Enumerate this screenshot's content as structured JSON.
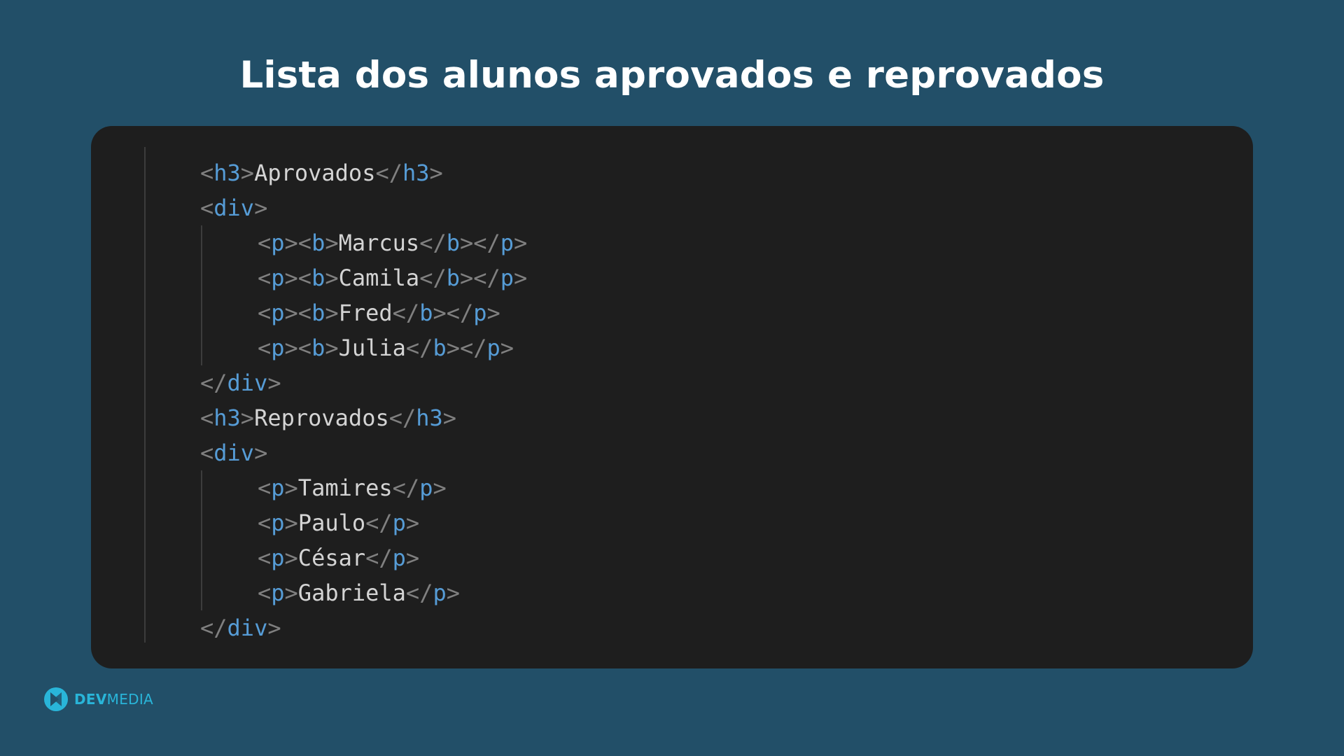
{
  "title": "Lista dos alunos aprovados e reprovados",
  "colors": {
    "background": "#224f68",
    "panel": "#1e1e1e",
    "tag": "#569cd6",
    "punctuation": "#808080",
    "text": "#d4d4d4",
    "brand": "#29b5d9"
  },
  "code": {
    "lines": [
      {
        "indent": 1,
        "tokens": [
          [
            "punct",
            "<"
          ],
          [
            "tag",
            "h3"
          ],
          [
            "punct",
            ">"
          ],
          [
            "text",
            "Aprovados"
          ],
          [
            "punct",
            "</"
          ],
          [
            "tag",
            "h3"
          ],
          [
            "punct",
            ">"
          ]
        ]
      },
      {
        "indent": 1,
        "tokens": [
          [
            "punct",
            "<"
          ],
          [
            "tag",
            "div"
          ],
          [
            "punct",
            ">"
          ]
        ]
      },
      {
        "indent": 2,
        "tokens": [
          [
            "punct",
            "<"
          ],
          [
            "tag",
            "p"
          ],
          [
            "punct",
            "><"
          ],
          [
            "tag",
            "b"
          ],
          [
            "punct",
            ">"
          ],
          [
            "text",
            "Marcus"
          ],
          [
            "punct",
            "</"
          ],
          [
            "tag",
            "b"
          ],
          [
            "punct",
            "></"
          ],
          [
            "tag",
            "p"
          ],
          [
            "punct",
            ">"
          ]
        ]
      },
      {
        "indent": 2,
        "tokens": [
          [
            "punct",
            "<"
          ],
          [
            "tag",
            "p"
          ],
          [
            "punct",
            "><"
          ],
          [
            "tag",
            "b"
          ],
          [
            "punct",
            ">"
          ],
          [
            "text",
            "Camila"
          ],
          [
            "punct",
            "</"
          ],
          [
            "tag",
            "b"
          ],
          [
            "punct",
            "></"
          ],
          [
            "tag",
            "p"
          ],
          [
            "punct",
            ">"
          ]
        ]
      },
      {
        "indent": 2,
        "tokens": [
          [
            "punct",
            "<"
          ],
          [
            "tag",
            "p"
          ],
          [
            "punct",
            "><"
          ],
          [
            "tag",
            "b"
          ],
          [
            "punct",
            ">"
          ],
          [
            "text",
            "Fred"
          ],
          [
            "punct",
            "</"
          ],
          [
            "tag",
            "b"
          ],
          [
            "punct",
            "></"
          ],
          [
            "tag",
            "p"
          ],
          [
            "punct",
            ">"
          ]
        ]
      },
      {
        "indent": 2,
        "tokens": [
          [
            "punct",
            "<"
          ],
          [
            "tag",
            "p"
          ],
          [
            "punct",
            "><"
          ],
          [
            "tag",
            "b"
          ],
          [
            "punct",
            ">"
          ],
          [
            "text",
            "Julia"
          ],
          [
            "punct",
            "</"
          ],
          [
            "tag",
            "b"
          ],
          [
            "punct",
            "></"
          ],
          [
            "tag",
            "p"
          ],
          [
            "punct",
            ">"
          ]
        ]
      },
      {
        "indent": 1,
        "tokens": [
          [
            "punct",
            "</"
          ],
          [
            "tag",
            "div"
          ],
          [
            "punct",
            ">"
          ]
        ]
      },
      {
        "indent": 1,
        "tokens": [
          [
            "punct",
            "<"
          ],
          [
            "tag",
            "h3"
          ],
          [
            "punct",
            ">"
          ],
          [
            "text",
            "Reprovados"
          ],
          [
            "punct",
            "</"
          ],
          [
            "tag",
            "h3"
          ],
          [
            "punct",
            ">"
          ]
        ]
      },
      {
        "indent": 1,
        "tokens": [
          [
            "punct",
            "<"
          ],
          [
            "tag",
            "div"
          ],
          [
            "punct",
            ">"
          ]
        ]
      },
      {
        "indent": 2,
        "tokens": [
          [
            "punct",
            "<"
          ],
          [
            "tag",
            "p"
          ],
          [
            "punct",
            ">"
          ],
          [
            "text",
            "Tamires"
          ],
          [
            "punct",
            "</"
          ],
          [
            "tag",
            "p"
          ],
          [
            "punct",
            ">"
          ]
        ]
      },
      {
        "indent": 2,
        "tokens": [
          [
            "punct",
            "<"
          ],
          [
            "tag",
            "p"
          ],
          [
            "punct",
            ">"
          ],
          [
            "text",
            "Paulo"
          ],
          [
            "punct",
            "</"
          ],
          [
            "tag",
            "p"
          ],
          [
            "punct",
            ">"
          ]
        ]
      },
      {
        "indent": 2,
        "tokens": [
          [
            "punct",
            "<"
          ],
          [
            "tag",
            "p"
          ],
          [
            "punct",
            ">"
          ],
          [
            "text",
            "César"
          ],
          [
            "punct",
            "</"
          ],
          [
            "tag",
            "p"
          ],
          [
            "punct",
            ">"
          ]
        ]
      },
      {
        "indent": 2,
        "tokens": [
          [
            "punct",
            "<"
          ],
          [
            "tag",
            "p"
          ],
          [
            "punct",
            ">"
          ],
          [
            "text",
            "Gabriela"
          ],
          [
            "punct",
            "</"
          ],
          [
            "tag",
            "p"
          ],
          [
            "punct",
            ">"
          ]
        ]
      },
      {
        "indent": 1,
        "tokens": [
          [
            "punct",
            "</"
          ],
          [
            "tag",
            "div"
          ],
          [
            "punct",
            ">"
          ]
        ]
      }
    ]
  },
  "brand": {
    "name_bold": "DEV",
    "name_light": "MEDIA"
  }
}
